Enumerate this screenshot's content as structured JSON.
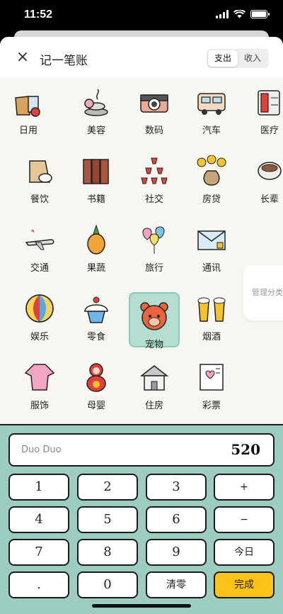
{
  "status": {
    "time": "11:52"
  },
  "header": {
    "close_icon": "close-icon",
    "title": "记一笔账",
    "tab_expense": "支出",
    "tab_income": "收入",
    "active_tab": "支出"
  },
  "categories": [
    {
      "label": "日用",
      "icon": "daily-goods-icon"
    },
    {
      "label": "美容",
      "icon": "beauty-icon"
    },
    {
      "label": "数码",
      "icon": "camera-icon"
    },
    {
      "label": "汽车",
      "icon": "car-icon"
    },
    {
      "label": "医疗",
      "icon": "medicine-cabinet-icon"
    },
    {
      "label": "餐饮",
      "icon": "rice-icon"
    },
    {
      "label": "书籍",
      "icon": "books-icon"
    },
    {
      "label": "社交",
      "icon": "wine-glasses-icon"
    },
    {
      "label": "房贷",
      "icon": "money-bag-icon"
    },
    {
      "label": "长辈",
      "icon": "teacup-icon"
    },
    {
      "label": "交通",
      "icon": "airplane-icon"
    },
    {
      "label": "果蔬",
      "icon": "pineapple-icon"
    },
    {
      "label": "旅行",
      "icon": "balloons-icon"
    },
    {
      "label": "通讯",
      "icon": "mail-icon"
    },
    {
      "label": "娱乐",
      "icon": "beach-ball-icon"
    },
    {
      "label": "零食",
      "icon": "cupcake-icon"
    },
    {
      "label": "宠物",
      "icon": "bear-icon"
    },
    {
      "label": "烟酒",
      "icon": "beer-icon"
    },
    {
      "label": "服饰",
      "icon": "robe-icon"
    },
    {
      "label": "母婴",
      "icon": "doll-icon"
    },
    {
      "label": "住房",
      "icon": "house-icon"
    },
    {
      "label": "彩票",
      "icon": "lottery-ticket-icon"
    }
  ],
  "selected_category": "宠物",
  "manage_label": "管理分类",
  "entry": {
    "note": "Duo Duo",
    "amount": "520"
  },
  "keys": {
    "k1": "1",
    "k2": "2",
    "k3": "3",
    "plus": "+",
    "k4": "4",
    "k5": "5",
    "k6": "6",
    "minus": "−",
    "k7": "7",
    "k8": "8",
    "k9": "9",
    "today": "今日",
    "dot": ".",
    "k0": "0",
    "clear": "清零",
    "done": "完成"
  },
  "colors": {
    "keypad_bg": "#9ccdc0",
    "done_btn": "#fbc21a",
    "selected_bg": "#b5ddd2"
  }
}
